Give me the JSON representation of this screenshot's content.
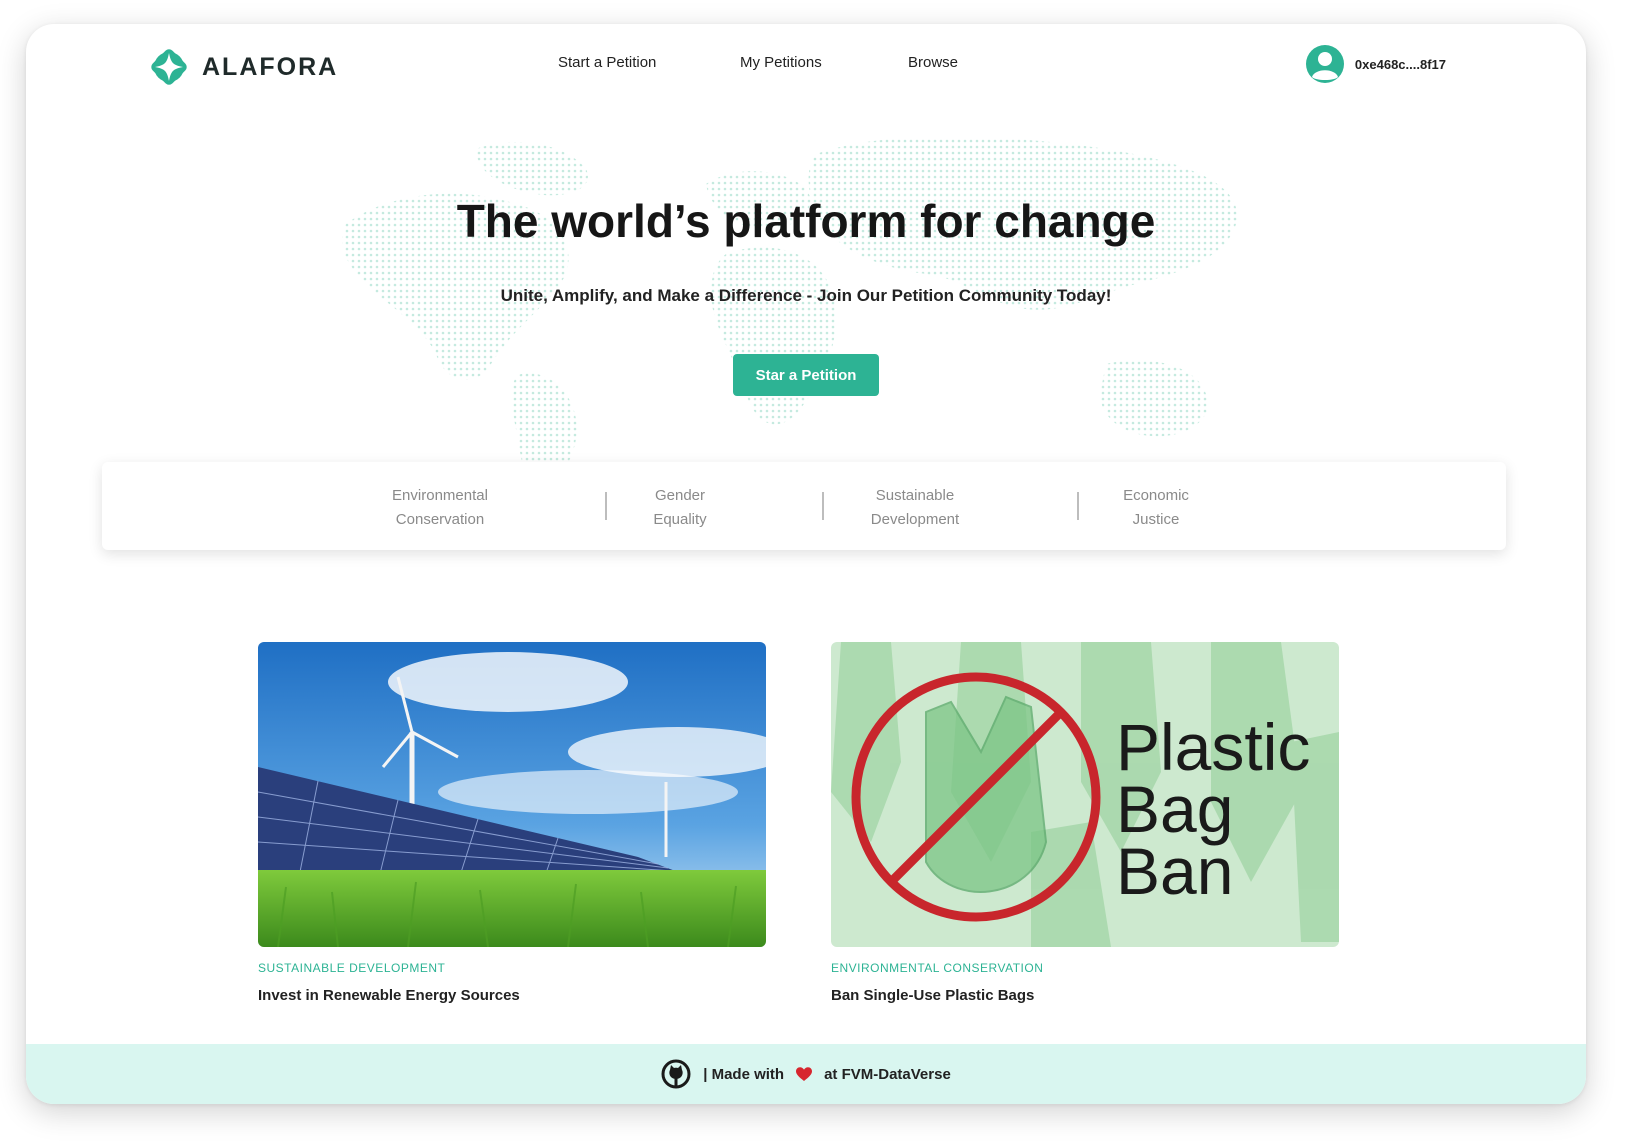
{
  "header": {
    "logo_text": "ALAFORA",
    "nav": {
      "start": "Start a Petition",
      "mine": "My Petitions",
      "browse": "Browse"
    },
    "wallet_address": "0xe468c....8f17"
  },
  "hero": {
    "title": "The world’s platform for change",
    "subtitle": "Unite, Amplify, and Make a Difference - Join Our Petition Community Today!",
    "cta_label": "Star a Petition"
  },
  "categories": [
    {
      "line1": "Environmental",
      "line2": "Conservation"
    },
    {
      "line1": "Gender",
      "line2": "Equality"
    },
    {
      "line1": "Sustainable",
      "line2": "Development"
    },
    {
      "line1": "Economic",
      "line2": "Justice"
    }
  ],
  "petitions": [
    {
      "tag": "SUSTAINABLE DEVELOPMENT",
      "title": "Invest in Renewable Energy Sources",
      "image": "solar-panels-wind-turbine"
    },
    {
      "tag": "ENVIRONMENTAL CONSERVATION",
      "title": "Ban Single-Use Plastic Bags",
      "image": "plastic-bag-ban",
      "image_text": [
        "Plastic",
        "Bag",
        "Ban"
      ]
    }
  ],
  "footer": {
    "text_before": "| Made with",
    "text_after": "at FVM-DataVerse",
    "icons": [
      "github-icon",
      "heart-icon"
    ]
  },
  "colors": {
    "accent": "#2db394",
    "footer_bg": "#d9f6f0",
    "ban_red": "#c8262c"
  }
}
